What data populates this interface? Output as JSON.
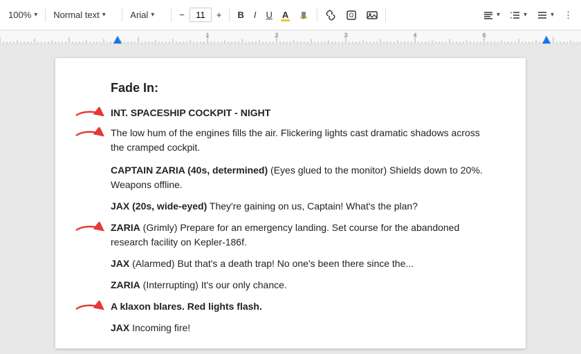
{
  "toolbar": {
    "zoom": "100%",
    "style": "Normal text",
    "font": "Arial",
    "fontSize": "11",
    "bold": "B",
    "italic": "I",
    "underline": "U",
    "colorA": "A",
    "highlighter": "🖊",
    "link": "🔗",
    "insertSpecial": "⊞",
    "insertImage": "🖼",
    "align": "≡",
    "lineSpacing": "↕",
    "listOptions": "☰"
  },
  "document": {
    "fadeIn": "Fade In:",
    "sceneHeading": "INT. SPACESHIP COCKPIT - NIGHT",
    "actionText": "The low hum of the engines fills the air. Flickering lights cast dramatic shadows across the cramped cockpit.",
    "char1Name": "CAPTAIN ZARIA (40s, determined)",
    "char1Direction": "(Eyes glued to the monitor)",
    "char1Line": "Shields down to 20%. Weapons offline.",
    "char2Name": "JAX (20s, wide-eyed)",
    "char2Line": "They're gaining on us, Captain! What's the plan?",
    "char3Name": "ZARIA",
    "char3Direction": "(Grimly)",
    "char3Line": "Prepare for an emergency landing. Set course for the abandoned research facility on Kepler-186f.",
    "char4Name": "JAX",
    "char4Direction": "(Alarmed)",
    "char4Line": "But that's a death trap! No one's been there since the...",
    "char5Name": "ZARIA",
    "char5Direction": "(Interrupting)",
    "char5Line": "It's our only chance.",
    "actionBold": "A klaxon blares. Red lights flash.",
    "char6Name": "JAX",
    "char6Line": "Incoming fire!"
  }
}
